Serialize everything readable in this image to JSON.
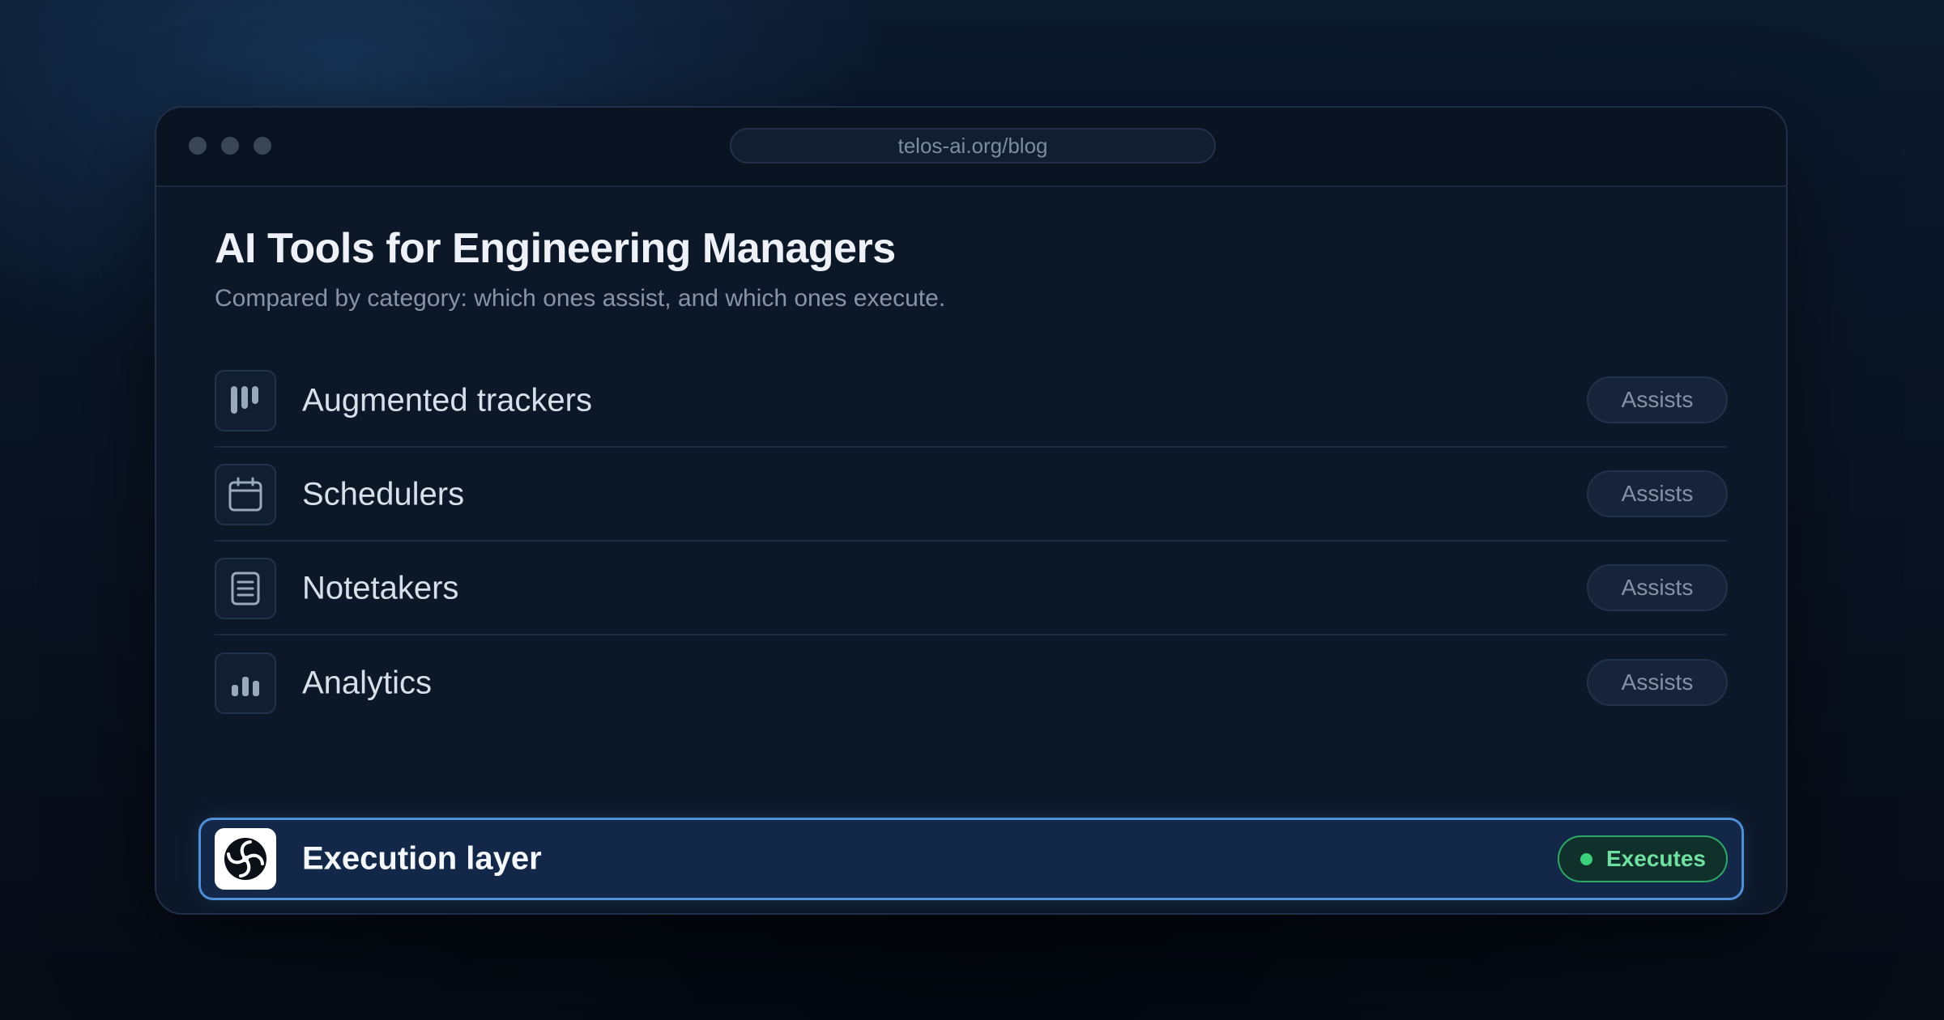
{
  "browser": {
    "url": "telos-ai.org/blog"
  },
  "article": {
    "title": "AI Tools for Engineering Managers",
    "subtitle": "Compared by category: which ones assist, and which ones execute."
  },
  "rows": [
    {
      "label": "Augmented trackers",
      "icon": "kanban-columns-icon",
      "badge": "Assists"
    },
    {
      "label": "Schedulers",
      "icon": "calendar-icon",
      "badge": "Assists"
    },
    {
      "label": "Notetakers",
      "icon": "document-icon",
      "badge": "Assists"
    },
    {
      "label": "Analytics",
      "icon": "bar-chart-icon",
      "badge": "Assists"
    },
    {
      "label": "Execution layer",
      "icon": "telos-logo-icon",
      "badge": "Executes",
      "highlighted": true
    }
  ],
  "colors": {
    "highlight_border": "#4f8fd8",
    "executes_green": "#3bd17c",
    "assists_text": "#8592a6"
  }
}
